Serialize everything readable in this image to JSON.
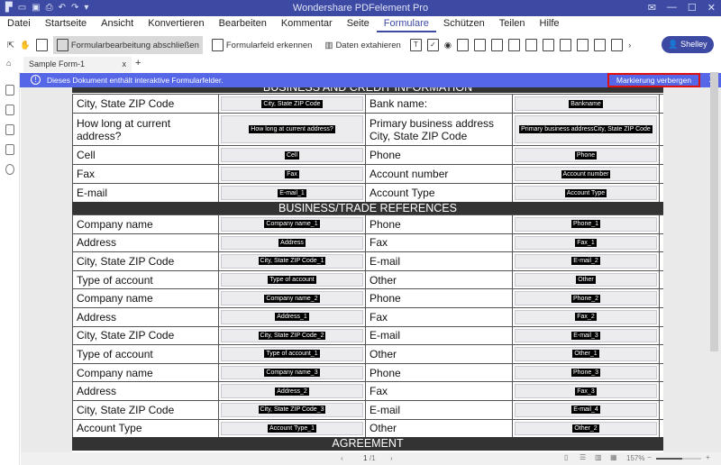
{
  "app": {
    "title": "Wondershare PDFelement Pro"
  },
  "menu": [
    "Datei",
    "Startseite",
    "Ansicht",
    "Konvertieren",
    "Bearbeiten",
    "Kommentar",
    "Seite",
    "Formulare",
    "Schützen",
    "Teilen",
    "Hilfe"
  ],
  "menu_active": "Formulare",
  "toolbar": {
    "finish_label": "Formularbearbeitung abschließen",
    "recognize_label": "Formularfeld erkennen",
    "extract_label": "Daten extahieren",
    "user": "Shelley"
  },
  "tab": {
    "label": "Sample Form-1",
    "close": "x",
    "add": "+"
  },
  "info": {
    "message": "Dieses Dokument enthält interaktive Formularfelder.",
    "hide_button": "Markierung verbergen",
    "close": "X"
  },
  "form": {
    "header1": "BUSINESS AND CREDIT INFORMATION",
    "header2": "BUSINESS/TRADE REFERENCES",
    "header3": "AGREEMENT",
    "rows1": [
      [
        "City, State ZIP Code",
        "City, State ZIP Code",
        "Bank name:",
        "Bankname"
      ],
      [
        "How long at current address?",
        "How long at current address?",
        "Primary business address City, State ZIP Code",
        "Primary business addressCity, State ZIP Code"
      ],
      [
        "Cell",
        "Cell",
        "Phone",
        "Phone"
      ],
      [
        "Fax",
        "Fax",
        "Account number",
        "Account number"
      ],
      [
        "E-mail",
        "E-mail_1",
        "Account Type",
        "Account Type"
      ]
    ],
    "rows2": [
      [
        "Company name",
        "Company name_1",
        "Phone",
        "Phone_1"
      ],
      [
        "Address",
        "Address",
        "Fax",
        "Fax_1"
      ],
      [
        "City, State ZIP Code",
        "City, State ZIP Code_1",
        "E-mail",
        "E-mail_2"
      ],
      [
        "Type of account",
        "Type of account",
        "Other",
        "Other"
      ],
      [
        "Company name",
        "Company name_2",
        "Phone",
        "Phone_2"
      ],
      [
        "Address",
        "Address_1",
        "Fax",
        "Fax_2"
      ],
      [
        "City, State ZIP Code",
        "City, State ZIP Code_2",
        "E-mail",
        "E-mail_3"
      ],
      [
        "Type of account",
        "Type of account_1",
        "Other",
        "Other_1"
      ],
      [
        "Company name",
        "Company name_3",
        "Phone",
        "Phone_3"
      ],
      [
        "Address",
        "Address_2",
        "Fax",
        "Fax_3"
      ],
      [
        "City, State ZIP Code",
        "City, State ZIP Code_3",
        "E-mail",
        "E-mail_4"
      ],
      [
        "Account Type",
        "Account Type_1",
        "Other",
        "Other_2"
      ]
    ]
  },
  "status": {
    "page": "1",
    "total": "/1",
    "zoom": "157%",
    "minus": "−",
    "plus": "+"
  }
}
